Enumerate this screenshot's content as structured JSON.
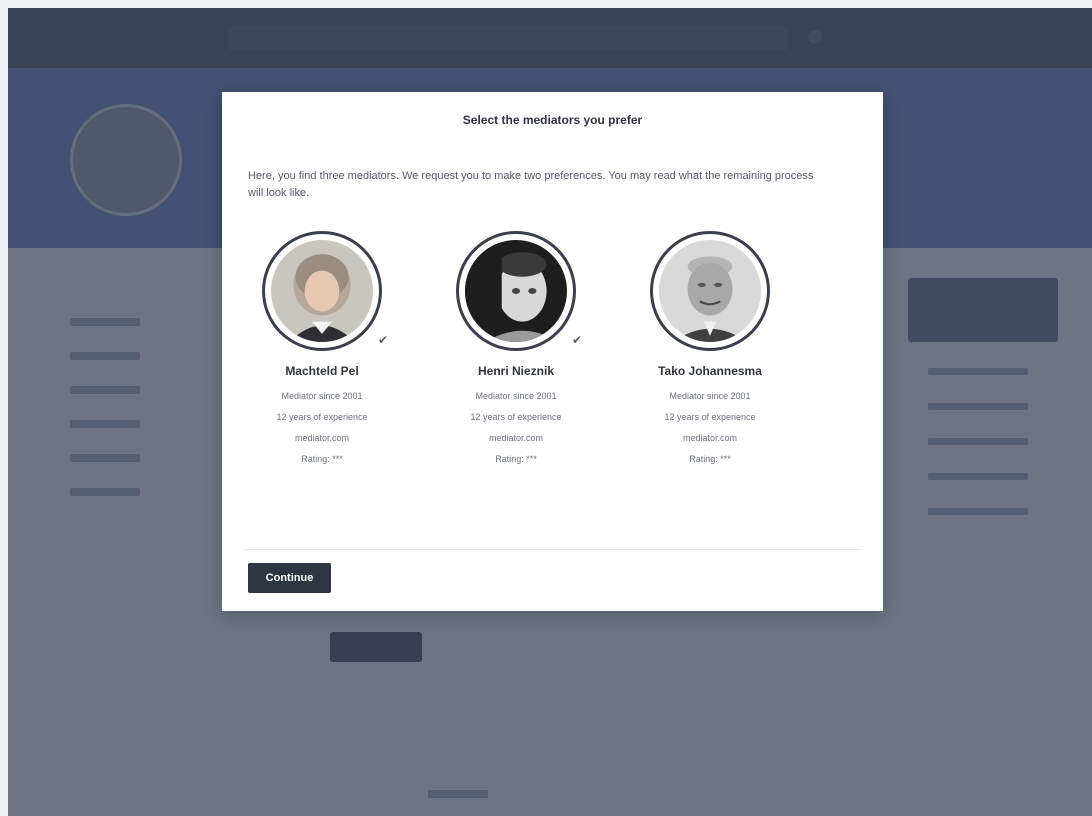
{
  "modal": {
    "title": "Select the mediators you prefer",
    "description": "Here, you find three mediators. We request you to make two preferences. You may read what the remaining process will look like.",
    "continue_label": "Continue"
  },
  "mediators": [
    {
      "name": "Machteld Pel",
      "since": "Mediator since 2001",
      "experience": "12 years of experience",
      "website": "mediator.com",
      "rating": "Rating: ***",
      "selected": true
    },
    {
      "name": "Henri Nieznik",
      "since": "Mediator since 2001",
      "experience": "12 years of experience",
      "website": "mediator.com",
      "rating": "Rating: ***",
      "selected": true
    },
    {
      "name": "Tako Johannesma",
      "since": "Mediator since 2001",
      "experience": "12 years of experience",
      "website": "mediator.com",
      "rating": "Rating: ***",
      "selected": false
    }
  ],
  "icons": {
    "check": "check-icon"
  },
  "colors": {
    "primary_button": "#2f3442",
    "overlay": "#3a4358",
    "hero": "#5a7ab8"
  }
}
